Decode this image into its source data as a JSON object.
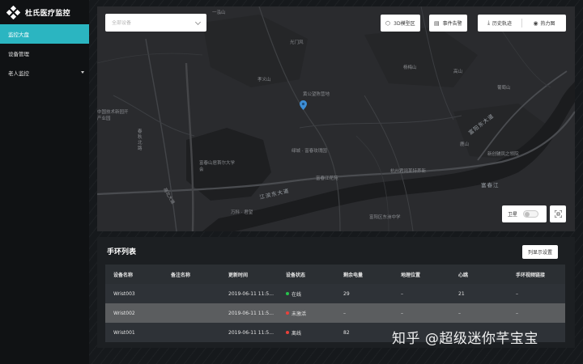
{
  "app": {
    "title": "杜氏医疗监控"
  },
  "sidebar": {
    "items": [
      {
        "label": "监控大盘",
        "active": true
      },
      {
        "label": "设备管理",
        "active": false
      },
      {
        "label": "老人监控",
        "active": false,
        "expandable": true
      }
    ]
  },
  "map": {
    "device_select": {
      "placeholder": "全部设备",
      "icon": "chevron-down-icon"
    },
    "toolbar": {
      "model3d": "3D模型区",
      "events": "事件告警",
      "history": "历史轨迹",
      "heatmap": "热力图"
    },
    "satellite_label": "卫星",
    "labels": {
      "l1": "一泓山",
      "l2": "光门风",
      "l3": "孝义山",
      "l4": "黄公望陈营地",
      "l5": "杨梅山",
      "l6": "高山",
      "l7": "葡萄山",
      "l8": "中国技术新园开产业园",
      "l9": "富春山居首尔大学会",
      "l10": "绿城 · 富春玫瑰园",
      "l11": "杭州君阔某特养新",
      "l12": "鹿山",
      "l13": "新创辅凤之领院",
      "l14": "富春江",
      "l15": "富阳区东洲中学",
      "l16": "万科 · 君望",
      "l17": "富春江花苑",
      "l18": "江滨东大道",
      "l19": "富春江",
      "l20": "富阳东大道",
      "l21": "春秋北路",
      "l22": "高北大道",
      "l23": "新阳路"
    }
  },
  "list": {
    "title": "手环列表",
    "column_button": "列显示设置",
    "columns": [
      "设备名称",
      "备注名称",
      "更新时间",
      "设备状态",
      "剩余电量",
      "地理位置",
      "心跳",
      "手环视频链接"
    ],
    "rows": [
      {
        "name": "Wrist003",
        "note": "",
        "time": "2019-06-11 11:5...",
        "status": "在线",
        "status_color": "#27c24c",
        "battery": "29",
        "location": "–",
        "heartbeat": "21",
        "video": "–"
      },
      {
        "name": "Wrist002",
        "note": "",
        "time": "2019-06-11 11:5...",
        "status": "未激活",
        "status_color": "#e8413b",
        "battery": "–",
        "location": "–",
        "heartbeat": "–",
        "video": "–"
      },
      {
        "name": "Wrist001",
        "note": "",
        "time": "2019-06-11 11:5...",
        "status": "离线",
        "status_color": "#e8413b",
        "battery": "82",
        "location": "–",
        "heartbeat": "–",
        "video": "–"
      }
    ]
  },
  "watermark": "知乎 @超级迷你芊宝宝",
  "colors": {
    "accent": "#2bb5c1",
    "online": "#27c24c",
    "offline": "#e8413b"
  }
}
